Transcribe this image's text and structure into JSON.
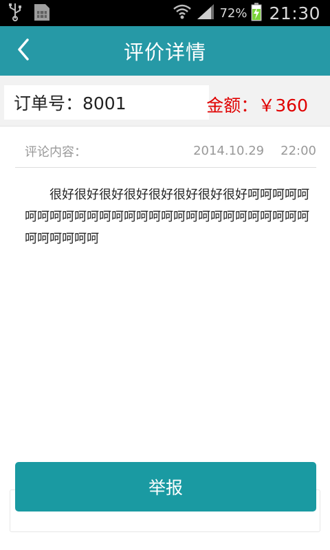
{
  "status_bar": {
    "icons": [
      "usb-icon",
      "sim-card-icon",
      "wifi-icon",
      "signal-icon",
      "battery-charging-icon"
    ],
    "battery_percent": "72%",
    "time": "21:30"
  },
  "header": {
    "title": "评价详情",
    "back_icon": "chevron-left-icon",
    "background_color": "#2699a6"
  },
  "order": {
    "number_text": "订单号：8001",
    "amount_text": "金额：￥360",
    "amount_color": "#e00000"
  },
  "comment": {
    "label": "评论内容：",
    "date": "2014.10.29",
    "time": "22:00",
    "content": "很好很好很好很好很好很好很好很好呵呵呵呵呵呵呵呵呵呵呵呵呵呵呵呵呵呵呵呵呵呵呵呵呵呵呵呵呵呵呵呵呵呵"
  },
  "actions": {
    "report_label": "举报",
    "report_color": "#1a9aa2"
  }
}
